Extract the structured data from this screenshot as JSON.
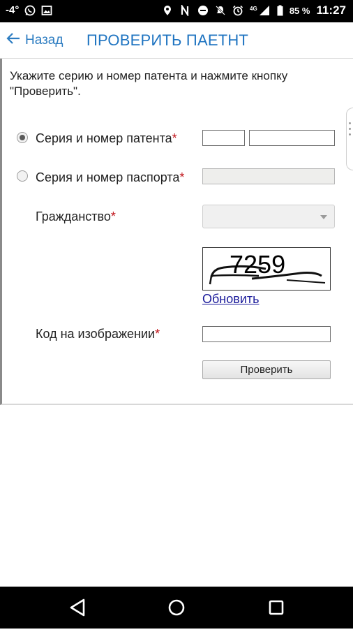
{
  "statusbar": {
    "temperature": "-4°",
    "network": "4G",
    "battery": "85 %",
    "time": "11:27"
  },
  "appbar": {
    "back_label": "Назад",
    "title": "ПРОВЕРИТЬ ПАЕТНТ"
  },
  "form": {
    "instruction": "Укажите серию и номер патента и нажмите кнопку \"Проверить\".",
    "option_patent": "Серия и номер патента",
    "option_passport": "Серия и номер паспорта",
    "citizenship_label": "Гражданство",
    "required_mark": "*",
    "captcha_text": "7259",
    "refresh_label": "Обновить",
    "code_label": "Код на изображении",
    "check_button": "Проверить",
    "selected_option": "patent"
  },
  "icons": {
    "status_left": [
      "whatsapp-icon",
      "image-icon"
    ],
    "status_right": [
      "location-icon",
      "nfc-icon",
      "do-not-disturb-icon",
      "notifications-off-icon",
      "alarm-icon",
      "signal-icon",
      "battery-icon"
    ],
    "nav": [
      "back-triangle-icon",
      "home-circle-icon",
      "recents-square-icon"
    ]
  },
  "colors": {
    "accent": "#1f74c1",
    "required": "#c0141a",
    "link": "#1a1a9a"
  }
}
